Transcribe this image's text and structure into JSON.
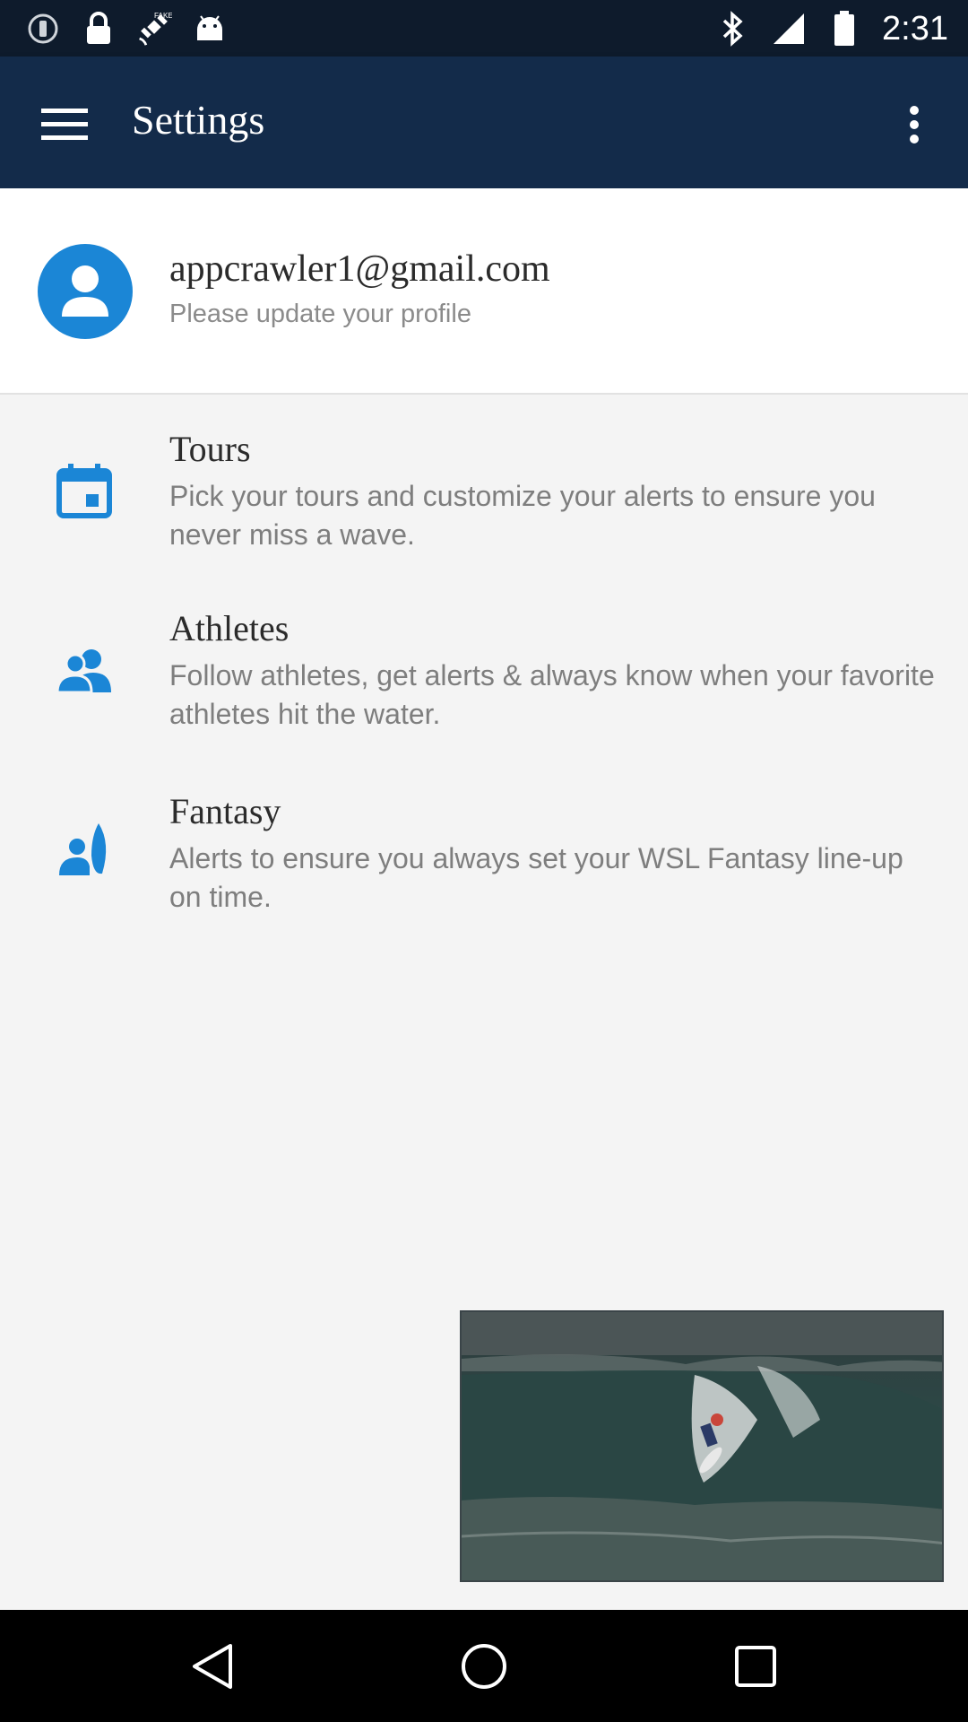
{
  "status_bar": {
    "time": "2:31",
    "icons": [
      "alert-icon",
      "lock-icon",
      "fake-gps-icon",
      "android-icon",
      "bluetooth-icon",
      "signal-icon",
      "battery-icon"
    ]
  },
  "app_bar": {
    "title": "Settings",
    "menu_icon": "hamburger-menu-icon",
    "overflow_icon": "more-vert-icon",
    "background": "#132b4a"
  },
  "profile": {
    "email": "appcrawler1@gmail.com",
    "hint": "Please update your profile",
    "accent": "#1b86d6"
  },
  "settings": [
    {
      "title": "Tours",
      "description": "Pick your tours and customize your alerts to ensure you never miss a wave.",
      "icon": "calendar-icon"
    },
    {
      "title": "Athletes",
      "description": "Follow athletes, get alerts & always know when your favorite athletes hit the water.",
      "icon": "people-icon"
    },
    {
      "title": "Fantasy",
      "description": "Alerts to ensure you always set your WSL Fantasy line-up on time.",
      "icon": "surfer-icon"
    }
  ],
  "video": {
    "content": "surfer-wave-thumbnail"
  },
  "nav_bar": {
    "buttons": [
      "back-icon",
      "home-icon",
      "recents-icon"
    ]
  }
}
